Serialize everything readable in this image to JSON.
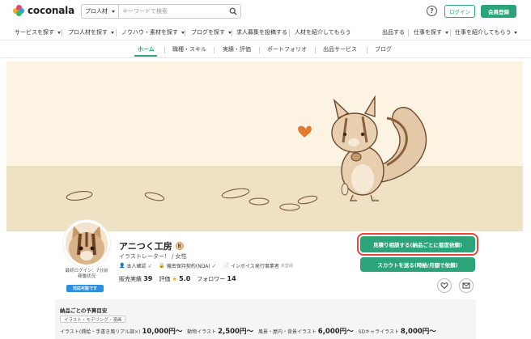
{
  "header": {
    "logo_text": "coconala",
    "search_scope": "プロ人材",
    "search_placeholder": "キーワードで検索",
    "login_label": "ログイン",
    "register_label": "会員登録"
  },
  "nav": {
    "items": [
      "サービスを探す",
      "プロ人材を探す",
      "ノウハウ・素材を探す",
      "ブログを探す",
      "求人募集を投稿する",
      "人材を紹介してもらう"
    ],
    "right_items": [
      "出品する",
      "仕事を探す",
      "仕事を紹介してもらう"
    ]
  },
  "tabs": [
    "ホーム",
    "職種・スキル",
    "実績・評価",
    "ポートフォリオ",
    "出品サービス",
    "ブログ"
  ],
  "profile": {
    "name": "アニつく工房",
    "rank": "B",
    "job_title": "イラストレーター！ / 女性",
    "last_login_line1": "最終ログイン：7分前",
    "last_login_line2": "稼働状況",
    "orders_badge": "対応可能です",
    "verifications": [
      "本人確認",
      "機密保持契約(NDA)",
      "インボイス発行事業者"
    ],
    "verification_pending": "未登録",
    "sales_label": "販売実績",
    "sales_value": "39",
    "rating_label": "評価",
    "rating_value": "5.0",
    "followers_label": "フォロワー",
    "followers_value": "14",
    "consult_label": "見積り相談する(納品ごとに都度依頼)",
    "scout_label": "スカウトを送る(時給/月額で依頼)"
  },
  "budget": {
    "title": "納品ごとの予算目安",
    "tag": "イラスト・モデリング・漫画",
    "items": [
      {
        "label": "イラスト(挿絵・手書き風リアル調×)",
        "price": "10,000円〜"
      },
      {
        "label": "動物イラスト",
        "price": "2,500円〜"
      },
      {
        "label": "風景・屋内・背景イラスト",
        "price": "6,000円〜"
      },
      {
        "label": "SDキャライラスト",
        "price": "8,000円〜"
      }
    ]
  },
  "colors": {
    "brand_green": "#2aa478",
    "highlight_red": "#e8453c",
    "badge_blue": "#2b8ee0",
    "cover_sky": "#fcf3e3",
    "cover_ground": "#efe1c3"
  }
}
